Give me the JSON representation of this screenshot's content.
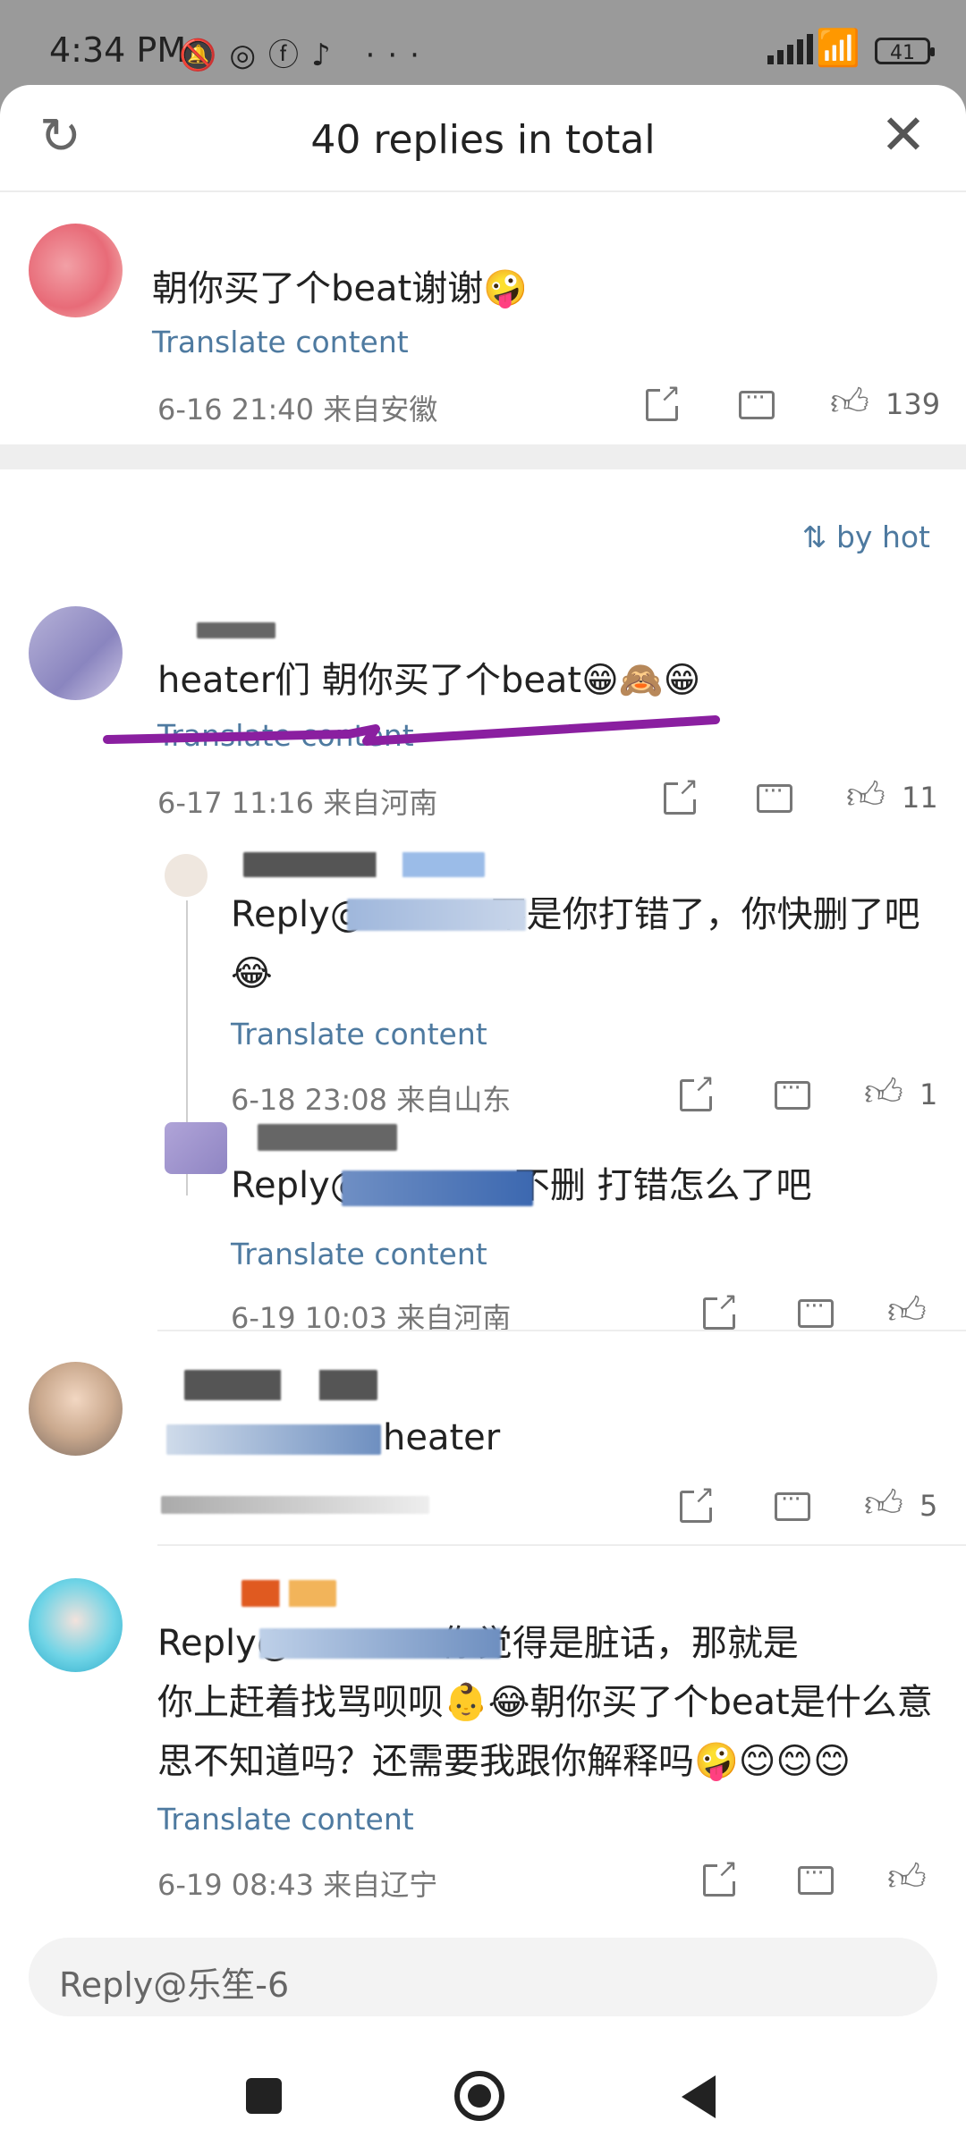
{
  "status_bar": {
    "time": "4:34 PM",
    "battery": "41",
    "icons": [
      "mute-icon",
      "weibo-icon",
      "facebook-icon",
      "tiktok-icon",
      "more-icon"
    ]
  },
  "header": {
    "title": "40 replies in total"
  },
  "main_comment": {
    "text": "朝你买了个beat谢谢🤪",
    "translate": "Translate content",
    "meta": "6-16 21:40 来自安徽",
    "likes": "139"
  },
  "sort": {
    "label": "by hot"
  },
  "comments": [
    {
      "text": "heater们 朝你买了个beat😁🙈😁",
      "translate": "Translate content",
      "meta": "6-17 11:16 来自河南",
      "likes": "11"
    },
    {
      "text": "Reply@           不是你打错了，你快删了吧😂",
      "translate": "Translate content",
      "meta": "6-18 23:08 来自山东",
      "likes": "1"
    },
    {
      "text": "Reply@            :不删 打错怎么了吧",
      "translate": "Translate content",
      "meta": "6-19 10:03 来自河南",
      "likes": ""
    },
    {
      "text": "heater",
      "likes": "5"
    },
    {
      "text_line1": "Reply@            :你觉得是脏话，那就是",
      "text_line2": "你上赶着找骂呗呗👶😂朝你买了个beat是什么意",
      "text_line3": "思不知道吗？还需要我跟你解释吗🤪😊😊😊",
      "translate": "Translate content",
      "meta": "6-19 08:43 来自辽宁",
      "likes": ""
    }
  ],
  "reply_box": {
    "placeholder": "Reply@乐笙-6"
  },
  "colors": {
    "link": "#4e7aa0",
    "annotation": "#8a1fa0"
  }
}
